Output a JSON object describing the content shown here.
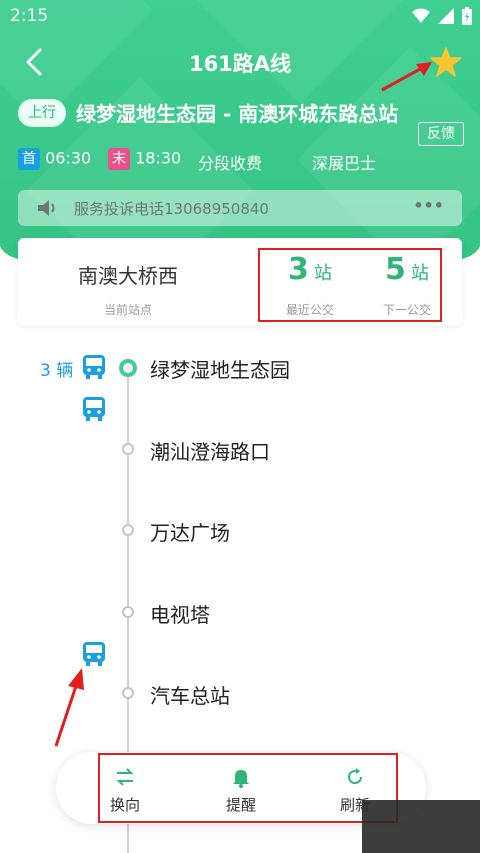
{
  "status_bar": {
    "time": "2:15"
  },
  "nav": {
    "title": "161路A线"
  },
  "route": {
    "direction": "上行",
    "name": "绿梦湿地生态园 - 南澳环城东路总站",
    "feedback": "反馈"
  },
  "info": {
    "first_tag": "首",
    "first_time": "06:30",
    "last_tag": "末",
    "last_time": "18:30",
    "fare": "分段收费",
    "company": "深展巴士"
  },
  "notice": {
    "text": "服务投诉电话13068950840",
    "more": "•••"
  },
  "station_card": {
    "current_station": "南澳大桥西",
    "current_label": "当前站点",
    "nearest": {
      "num": "3",
      "unit": "站",
      "label": "最近公交"
    },
    "next": {
      "num": "5",
      "unit": "站",
      "label": "下一公交"
    }
  },
  "bus_count": "3 辆",
  "stops": [
    "绿梦湿地生态园",
    "潮汕澄海路口",
    "万达广场",
    "电视塔",
    "汽车总站"
  ],
  "bottom_bar": {
    "switch": "换向",
    "remind": "提醒",
    "refresh": "刷新"
  },
  "colors": {
    "brand": "#3fcf90",
    "bus": "#1a9fe0",
    "star": "#f7c531",
    "annotation": "#e02020"
  }
}
